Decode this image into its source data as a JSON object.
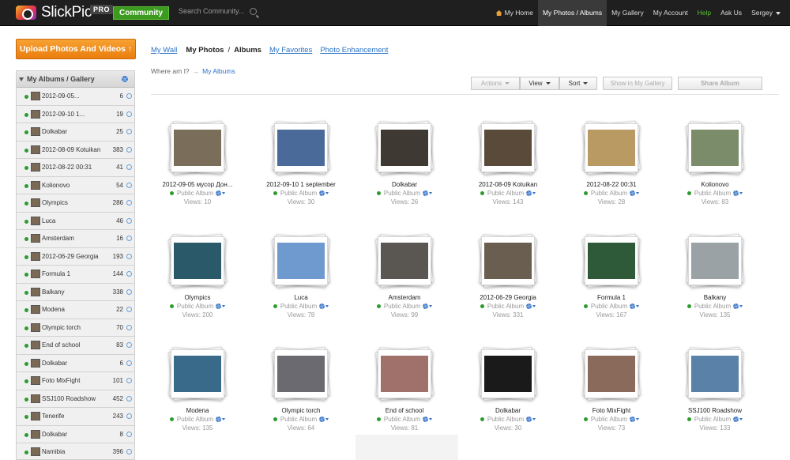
{
  "header": {
    "logo_text": "SlickPic",
    "pro_badge": "PRO",
    "community_label": "Community",
    "search_placeholder": "Search Community...",
    "nav": [
      {
        "label": "My Home",
        "icon": "home-icon"
      },
      {
        "label": "My Photos / Albums",
        "active": true
      },
      {
        "label": "My Gallery"
      },
      {
        "label": "My Account"
      },
      {
        "label": "Help",
        "color": "#5cbf3a"
      },
      {
        "label": "Ask Us"
      },
      {
        "label": "Sergey",
        "dropdown": true
      }
    ]
  },
  "sidebar": {
    "upload_label": "Upload Photos And Videos",
    "header_label": "My Albums / Gallery",
    "albums": [
      {
        "name": "2012-09-05...",
        "count": "6"
      },
      {
        "name": "2012-09-10 1...",
        "count": "19"
      },
      {
        "name": "Dolkabar",
        "count": "25"
      },
      {
        "name": "2012-08-09 Kotuikan",
        "count": "383"
      },
      {
        "name": "2012-08-22 00:31",
        "count": "41"
      },
      {
        "name": "Kolionovo",
        "count": "54"
      },
      {
        "name": "Olympics",
        "count": "286"
      },
      {
        "name": "Luca",
        "count": "46"
      },
      {
        "name": "Amsterdam",
        "count": "16"
      },
      {
        "name": "2012-06-29 Georgia",
        "count": "193"
      },
      {
        "name": "Formula 1",
        "count": "144"
      },
      {
        "name": "Balkany",
        "count": "338"
      },
      {
        "name": "Modena",
        "count": "22"
      },
      {
        "name": "Olympic torch",
        "count": "70"
      },
      {
        "name": "End of school",
        "count": "83"
      },
      {
        "name": "Dolkabar",
        "count": "6"
      },
      {
        "name": "Foto MixFight",
        "count": "101"
      },
      {
        "name": "SSJ100 Roadshow",
        "count": "452"
      },
      {
        "name": "Tenerife",
        "count": "243"
      },
      {
        "name": "Dolkabar",
        "count": "8"
      },
      {
        "name": "Namibia",
        "count": "396"
      }
    ]
  },
  "main": {
    "tabs": {
      "my_wall": "My Wall",
      "my_photos": "My Photos",
      "sep": "/",
      "albums": "Albums",
      "my_favorites": "My Favorites",
      "photo_enhancement": "Photo Enhancement"
    },
    "where": {
      "label": "Where am I?",
      "arrow": "→",
      "crumb": "My Albums"
    },
    "toolbar": {
      "actions": "Actions",
      "view": "View",
      "sort": "Sort",
      "show_in_gallery": "Show in My Gallery",
      "share_album": "Share Album"
    },
    "album_public_label": "Public Album",
    "albums": [
      {
        "title": "2012-09-05 мусор Дон...",
        "views": "Views: 10",
        "color": "#7a6e5a"
      },
      {
        "title": "2012-09-10 1 september",
        "views": "Views: 30",
        "color": "#4a6a9a"
      },
      {
        "title": "Dolkabar",
        "views": "Views: 26",
        "color": "#3e3a33"
      },
      {
        "title": "2012-08-09 Kotuikan",
        "views": "Views: 143",
        "color": "#5a4a3a"
      },
      {
        "title": "2012-08-22 00:31",
        "views": "Views: 28",
        "color": "#b99a62"
      },
      {
        "title": "Kolionovo",
        "views": "Views: 83",
        "color": "#7a8c6a"
      },
      {
        "title": "Olympics",
        "views": "Views: 200",
        "color": "#2a5a6a"
      },
      {
        "title": "Luca",
        "views": "Views: 78",
        "color": "#6e9ad0"
      },
      {
        "title": "Amsterdam",
        "views": "Views: 99",
        "color": "#5a5652"
      },
      {
        "title": "2012-06-29 Georgia",
        "views": "Views: 331",
        "color": "#6a5e50"
      },
      {
        "title": "Formula 1",
        "views": "Views: 167",
        "color": "#2e5a3a"
      },
      {
        "title": "Balkany",
        "views": "Views: 135",
        "color": "#9aa2a6"
      },
      {
        "title": "Modena",
        "views": "Views: 135",
        "color": "#3a6a8a"
      },
      {
        "title": "Olympic torch",
        "views": "Views: 64",
        "color": "#6a6a70"
      },
      {
        "title": "End of school",
        "views": "Views: 81",
        "color": "#a0706a"
      },
      {
        "title": "Dolkabar",
        "views": "Views: 30",
        "color": "#1a1a1a"
      },
      {
        "title": "Foto MixFight",
        "views": "Views: 73",
        "color": "#8a6a5a"
      },
      {
        "title": "SSJ100 Roadshow",
        "views": "Views: 133",
        "color": "#5a82a8"
      }
    ]
  }
}
